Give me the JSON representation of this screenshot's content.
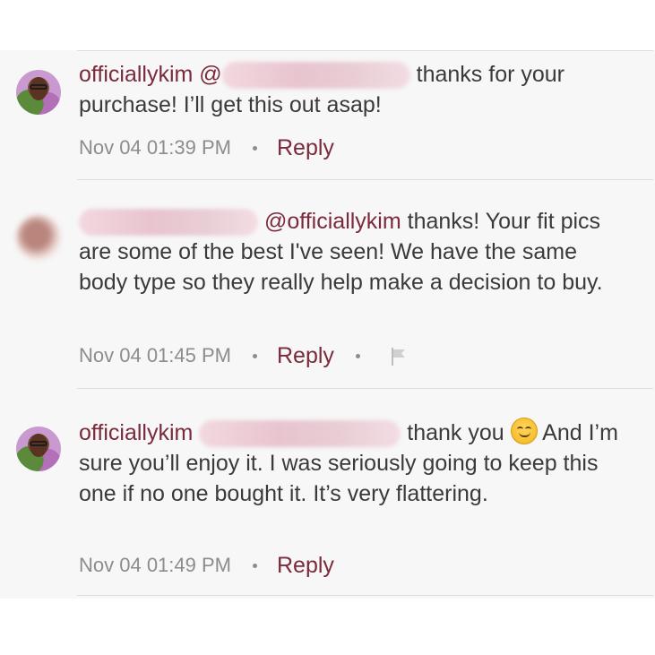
{
  "comments": [
    {
      "username": "officiallykim",
      "mention_prefix": "@",
      "text": "thanks for your purchase! I’ll get this out asap!",
      "timestamp": "Nov 04 01:39 PM",
      "reply_label": "Reply"
    },
    {
      "username": "",
      "mention": "@officiallykim",
      "text": " thanks!  Your fit pics are some of the best I've seen! We have the same body type so they really help make a decision to buy.",
      "timestamp": "Nov 04 01:45 PM",
      "reply_label": "Reply",
      "flag_icon": "flag-icon"
    },
    {
      "username": "officiallykim",
      "text_before_emoji": "thank you ",
      "emoji": "smiling-face-icon",
      "text_after_emoji": " And I’m sure you’ll enjoy it. I was seriously going to keep this one if no one bought it. It’s very flattering.",
      "timestamp": "Nov 04 01:49 PM",
      "reply_label": "Reply"
    }
  ],
  "colors": {
    "username": "#7b2a3b",
    "body_text": "#3a3a3a",
    "meta_text": "#8c8c8c",
    "panel_bg": "#f7f7f7"
  }
}
